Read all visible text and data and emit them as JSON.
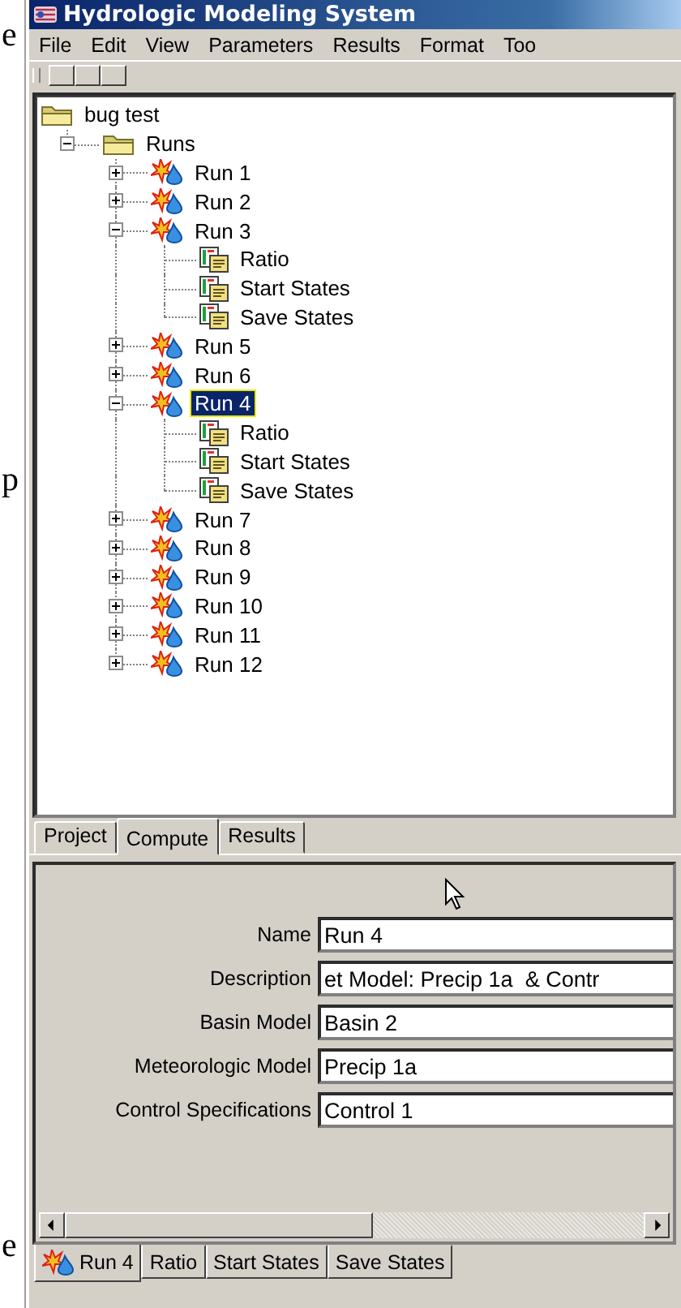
{
  "background_text": [
    "e",
    "p",
    "e"
  ],
  "window": {
    "title": "Hydrologic Modeling System"
  },
  "menu": [
    "File",
    "Edit",
    "View",
    "Parameters",
    "Results",
    "Format",
    "Too"
  ],
  "tree": [
    {
      "label": "bug test",
      "kind": "folder",
      "selected": false,
      "children": [
        {
          "label": "Runs",
          "kind": "folder",
          "expanded": true,
          "selected": false,
          "children": [
            {
              "label": "Run 1",
              "kind": "run",
              "expanded": false,
              "selected": false
            },
            {
              "label": "Run 2",
              "kind": "run",
              "expanded": false,
              "selected": false
            },
            {
              "label": "Run 3",
              "kind": "run",
              "expanded": true,
              "selected": false,
              "children": [
                {
                  "label": "Ratio",
                  "kind": "table",
                  "selected": false
                },
                {
                  "label": "Start States",
                  "kind": "table",
                  "selected": false
                },
                {
                  "label": "Save States",
                  "kind": "table",
                  "selected": false
                }
              ]
            },
            {
              "label": "Run 5",
              "kind": "run",
              "expanded": false,
              "selected": false
            },
            {
              "label": "Run 6",
              "kind": "run",
              "expanded": false,
              "selected": false
            },
            {
              "label": "Run 4",
              "kind": "run",
              "expanded": true,
              "selected": true,
              "children": [
                {
                  "label": "Ratio",
                  "kind": "table",
                  "selected": false
                },
                {
                  "label": "Start States",
                  "kind": "table",
                  "selected": false
                },
                {
                  "label": "Save States",
                  "kind": "table",
                  "selected": false
                }
              ]
            },
            {
              "label": "Run 7",
              "kind": "run",
              "expanded": false,
              "selected": false
            },
            {
              "label": "Run 8",
              "kind": "run",
              "expanded": false,
              "selected": false
            },
            {
              "label": "Run 9",
              "kind": "run",
              "expanded": false,
              "selected": false
            },
            {
              "label": "Run 10",
              "kind": "run",
              "expanded": false,
              "selected": false
            },
            {
              "label": "Run 11",
              "kind": "run",
              "expanded": false,
              "selected": false
            },
            {
              "label": "Run 12",
              "kind": "run",
              "expanded": false,
              "selected": false
            }
          ]
        }
      ]
    }
  ],
  "tabs": [
    {
      "label": "Project",
      "selected": false
    },
    {
      "label": "Compute",
      "selected": true
    },
    {
      "label": "Results",
      "selected": false
    }
  ],
  "form": [
    {
      "label": "Name",
      "value": "Run 4"
    },
    {
      "label": "Description",
      "value": "et Model: Precip 1a  & Contr"
    },
    {
      "label": "Basin Model",
      "value": "Basin 2"
    },
    {
      "label": "Meteorologic Model",
      "value": "Precip 1a"
    },
    {
      "label": "Control Specifications",
      "value": "Control 1"
    }
  ],
  "bottom_tabs": [
    {
      "label": "Run 4",
      "kind": "run",
      "selected": true
    },
    {
      "label": "Ratio",
      "kind": "text",
      "selected": false
    },
    {
      "label": "Start States",
      "kind": "text",
      "selected": false
    },
    {
      "label": "Save States",
      "kind": "text",
      "selected": false
    }
  ]
}
